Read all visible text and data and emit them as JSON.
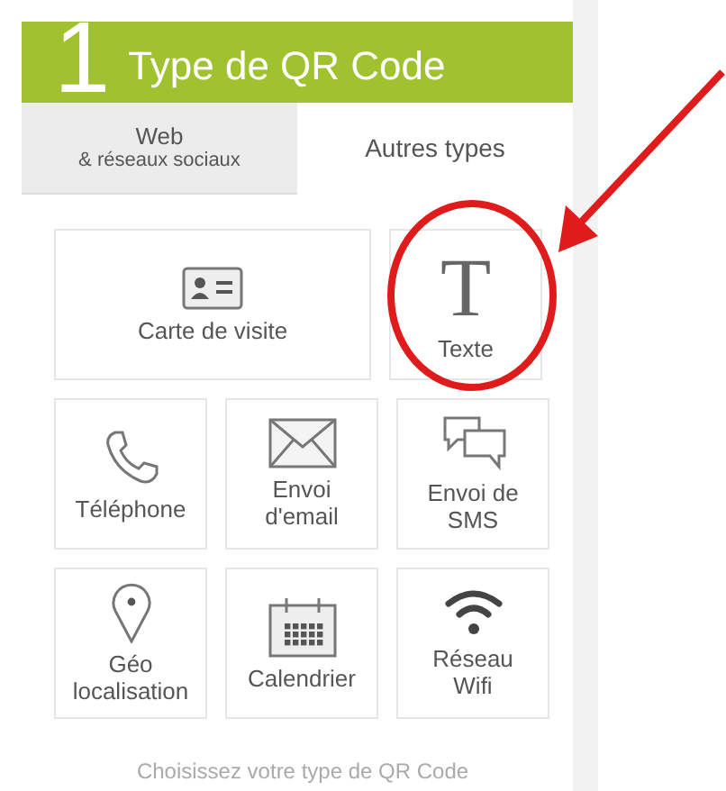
{
  "header": {
    "step": "1",
    "title": "Type de QR Code"
  },
  "tabs": [
    {
      "label": "Web",
      "sublabel": "& réseaux sociaux",
      "selected": false
    },
    {
      "label": "Autres types",
      "selected": true
    }
  ],
  "tiles": [
    [
      {
        "kind": "card",
        "label": "Carte de visite"
      },
      {
        "kind": "glyph",
        "glyph": "T",
        "label": "Texte",
        "highlighted": true
      }
    ],
    [
      {
        "kind": "phone",
        "label": "Téléphone"
      },
      {
        "kind": "mail",
        "label": "Envoi d'email"
      },
      {
        "kind": "sms",
        "label": "Envoi de SMS"
      }
    ],
    [
      {
        "kind": "pin",
        "label": "Géo localisation"
      },
      {
        "kind": "calendar",
        "label": "Calendrier"
      },
      {
        "kind": "wifi",
        "label": "Réseau Wifi"
      }
    ]
  ],
  "footer": "Choisissez votre type de QR Code"
}
